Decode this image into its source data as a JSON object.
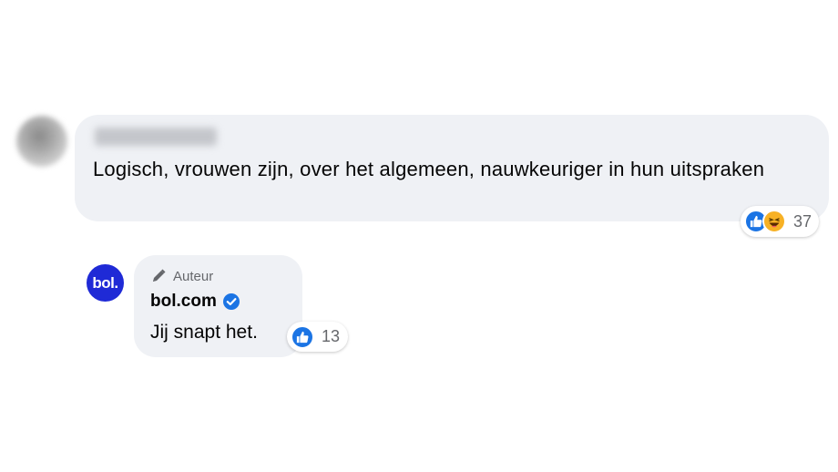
{
  "comment": {
    "author_name": "",
    "text": "Logisch, vrouwen zijn, over het algemeen, nauwkeuriger in hun uitspraken",
    "reactions": {
      "icons": [
        "like-icon",
        "haha-icon"
      ],
      "count": "37"
    }
  },
  "reply": {
    "avatar_text": "bol.",
    "author_badge": "Auteur",
    "author_name": "bol.com",
    "verified": true,
    "text": "Jij snapt het.",
    "reactions": {
      "icons": [
        "like-icon"
      ],
      "count": "13"
    }
  },
  "colors": {
    "bubble": "#eff1f5",
    "like": "#1b74e4",
    "haha": "#f7b125",
    "verified": "#1b74e4",
    "brand": "#1f2ad6",
    "muted_text": "#65676b"
  }
}
